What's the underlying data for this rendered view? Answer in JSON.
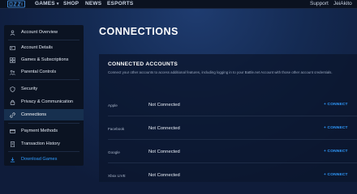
{
  "topnav": {
    "games": "GAMES",
    "shop": "SHOP",
    "news": "NEWS",
    "esports": "ESPORTS",
    "support": "Support",
    "user": "JeiAkito"
  },
  "sidebar": {
    "items": [
      {
        "label": "Account Overview",
        "icon": "user-icon"
      },
      {
        "label": "Account Details",
        "icon": "id-card-icon"
      },
      {
        "label": "Games & Subscriptions",
        "icon": "grid-icon"
      },
      {
        "label": "Parental Controls",
        "icon": "family-icon"
      },
      {
        "label": "Security",
        "icon": "shield-icon"
      },
      {
        "label": "Privacy & Communication",
        "icon": "lock-icon"
      },
      {
        "label": "Connections",
        "icon": "link-icon"
      },
      {
        "label": "Payment Methods",
        "icon": "credit-card-icon"
      },
      {
        "label": "Transaction History",
        "icon": "receipt-icon"
      },
      {
        "label": "Download Games",
        "icon": "download-icon"
      }
    ]
  },
  "page": {
    "title": "CONNECTIONS"
  },
  "connected_accounts": {
    "title": "CONNECTED ACCOUNTS",
    "description": "Connect your other accounts to access additional features, including logging in to your Battle.net Account with those other account credentials.",
    "rows": [
      {
        "name": "Apple",
        "status": "Not Connected",
        "action": "+ CONNECT"
      },
      {
        "name": "Facebook",
        "status": "Not Connected",
        "action": "+ CONNECT"
      },
      {
        "name": "Google",
        "status": "Not Connected",
        "action": "+ CONNECT"
      },
      {
        "name": "Xbox LIVE",
        "status": "Not Connected",
        "action": "+ CONNECT"
      }
    ]
  },
  "colors": {
    "accent": "#2f9bff",
    "background": "#0f1c3a",
    "sidebar": "#0b1322",
    "active_item": "#17304f"
  }
}
